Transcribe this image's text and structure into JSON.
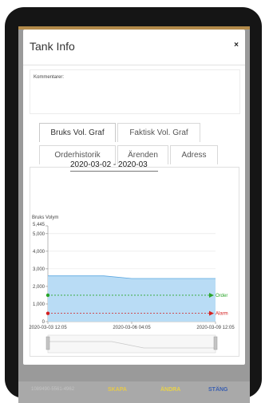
{
  "modal": {
    "title": "Tank Info",
    "close_label": "×",
    "comment_label": "Kommentarer:"
  },
  "tabs": [
    {
      "label": "Bruks Vol. Graf",
      "active": true
    },
    {
      "label": "Faktisk Vol. Graf",
      "active": false
    },
    {
      "label": "Orderhistorik",
      "active": false
    },
    {
      "label": "Ärenden",
      "active": false
    },
    {
      "label": "Adress",
      "active": false
    }
  ],
  "date_range": "2020-03-02 - 2020-03",
  "colors": {
    "area_fill": "#b9dcf5",
    "area_line": "#5aa6e0",
    "order": "#2aa52a",
    "alarm": "#d42020",
    "bottom_gray": "#bdbdbd",
    "bottom_yellow": "#e8d24a",
    "bottom_blue": "#3a5fb0"
  },
  "chart_data": {
    "type": "area",
    "ylabel": "Bruks Volym",
    "ylim": [
      0,
      5445
    ],
    "yticks": [
      "0",
      "1,000",
      "2,000",
      "3,000",
      "4,000",
      "5,000",
      "5,445"
    ],
    "x_labels": [
      "2020-03-03 12:05",
      "2020-03-06 04:05",
      "2020-03-09 12:05"
    ],
    "series": [
      {
        "x": [
          "2020-03-03 12:05",
          "2020-03-04 12:00",
          "2020-03-05 12:00",
          "2020-03-06 04:05",
          "2020-03-07 12:00",
          "2020-03-08 12:00",
          "2020-03-09 12:05"
        ],
        "values": [
          2600,
          2600,
          2600,
          2450,
          2450,
          2450,
          2450
        ]
      }
    ],
    "order_level": 1500,
    "order_label": "Order",
    "alarm_level": 470,
    "alarm_label": "Alarm"
  },
  "footer": {
    "left_text": "1089490-5561-4962",
    "skapa": "SKAPA",
    "andra": "ÄNDRA",
    "stang": "STÄNG"
  }
}
